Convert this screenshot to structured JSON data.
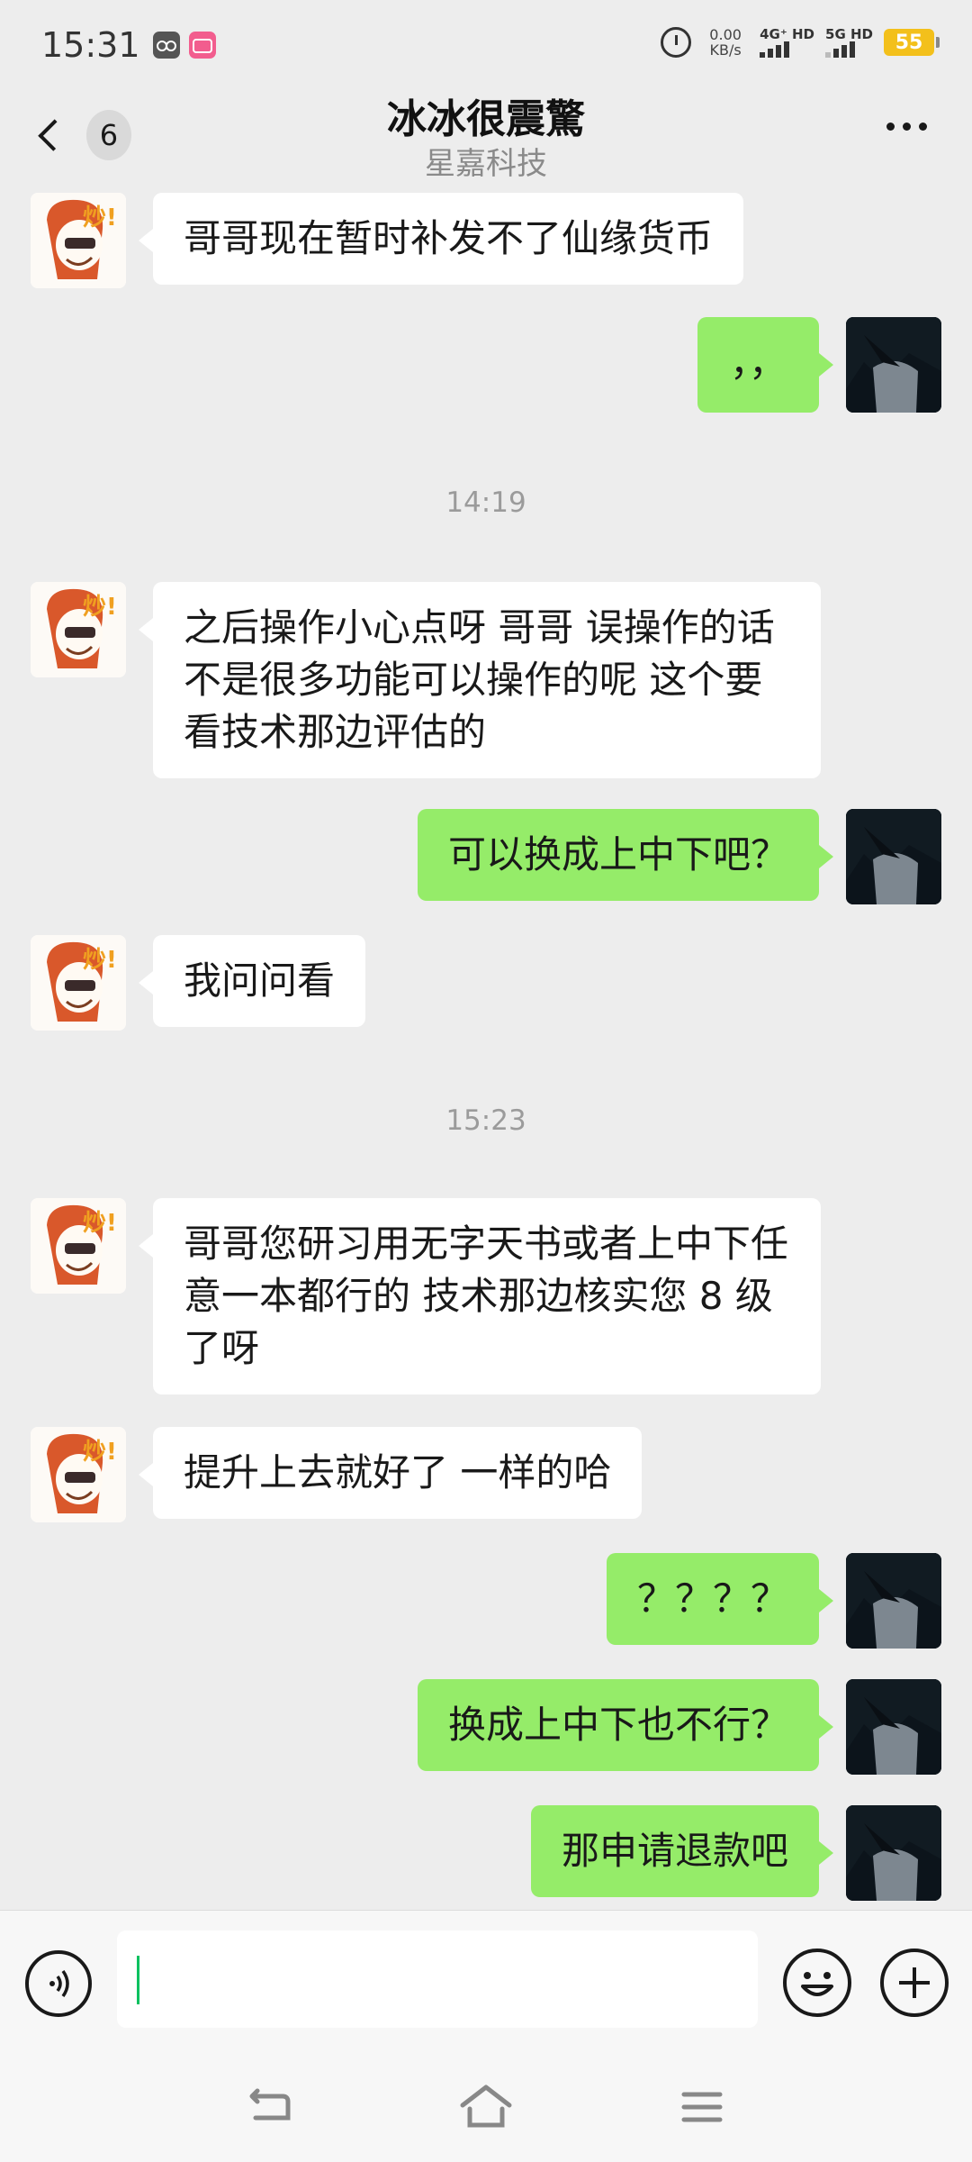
{
  "status_bar": {
    "time": "15:31",
    "net_speed_value": "0.00",
    "net_speed_unit": "KB/s",
    "sim1_label": "4G⁺ HD",
    "sim2_label": "5G HD",
    "battery": "55",
    "icons": [
      "app-icon",
      "bilibili-icon",
      "alarm-icon",
      "signal-icon",
      "battery-icon"
    ]
  },
  "header": {
    "title": "冰冰很震驚",
    "subtitle": "星嘉科技",
    "unread_count": "6"
  },
  "messages": [
    {
      "side": "in",
      "text": "哥哥现在暂时补发不了仙缘货币"
    },
    {
      "side": "out",
      "text": "，，"
    },
    {
      "type": "time",
      "text": "14:19"
    },
    {
      "side": "in",
      "text": "之后操作小心点呀 哥哥 误操作的话不是很多功能可以操作的呢 这个要看技术那边评估的"
    },
    {
      "side": "out",
      "text": "可以换成上中下吧？"
    },
    {
      "side": "in",
      "text": "我问问看"
    },
    {
      "type": "time",
      "text": "15:23"
    },
    {
      "side": "in",
      "text": "哥哥您研习用无字天书或者上中下任意一本都行的 技术那边核实您 8 级了呀"
    },
    {
      "side": "in",
      "text": "提升上去就好了 一样的哈"
    },
    {
      "side": "out",
      "text": "？？？？"
    },
    {
      "side": "out",
      "text": "换成上中下也不行？"
    },
    {
      "side": "out",
      "text": "那申请退款吧"
    }
  ],
  "input": {
    "value": "",
    "placeholder": ""
  },
  "colors": {
    "background": "#ededed",
    "outgoing_bubble": "#95ec69",
    "incoming_bubble": "#ffffff",
    "cursor": "#07c160",
    "battery": "#f3c01b"
  }
}
